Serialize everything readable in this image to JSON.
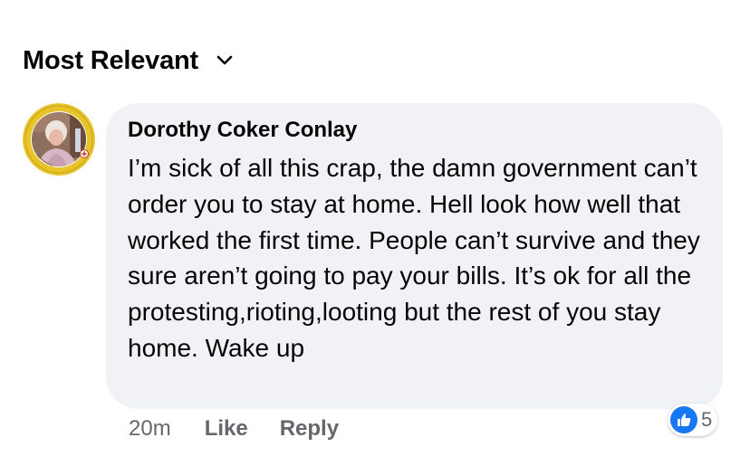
{
  "sort": {
    "label": "Most Relevant",
    "icon": "chevron-down-icon"
  },
  "comment": {
    "avatar_icon": "user-avatar",
    "author": "Dorothy Coker Conlay",
    "text": "I’m sick of all this crap, the damn government can’t order you to stay at home. Hell look how well that worked the first time. People can’t survive and they sure aren’t going to pay your bills. It’s ok for all the protesting,rioting,looting but the rest of you stay home. Wake up",
    "timestamp": "20m",
    "like_label": "Like",
    "reply_label": "Reply",
    "reactions": {
      "icon": "thumbs-up-icon",
      "count": "5",
      "color": "#1877f2"
    }
  },
  "colors": {
    "bubble_bg": "#f0f2f5",
    "text": "#050505",
    "secondary_text": "#65676b",
    "avatar_ring": "#e8c32a"
  }
}
